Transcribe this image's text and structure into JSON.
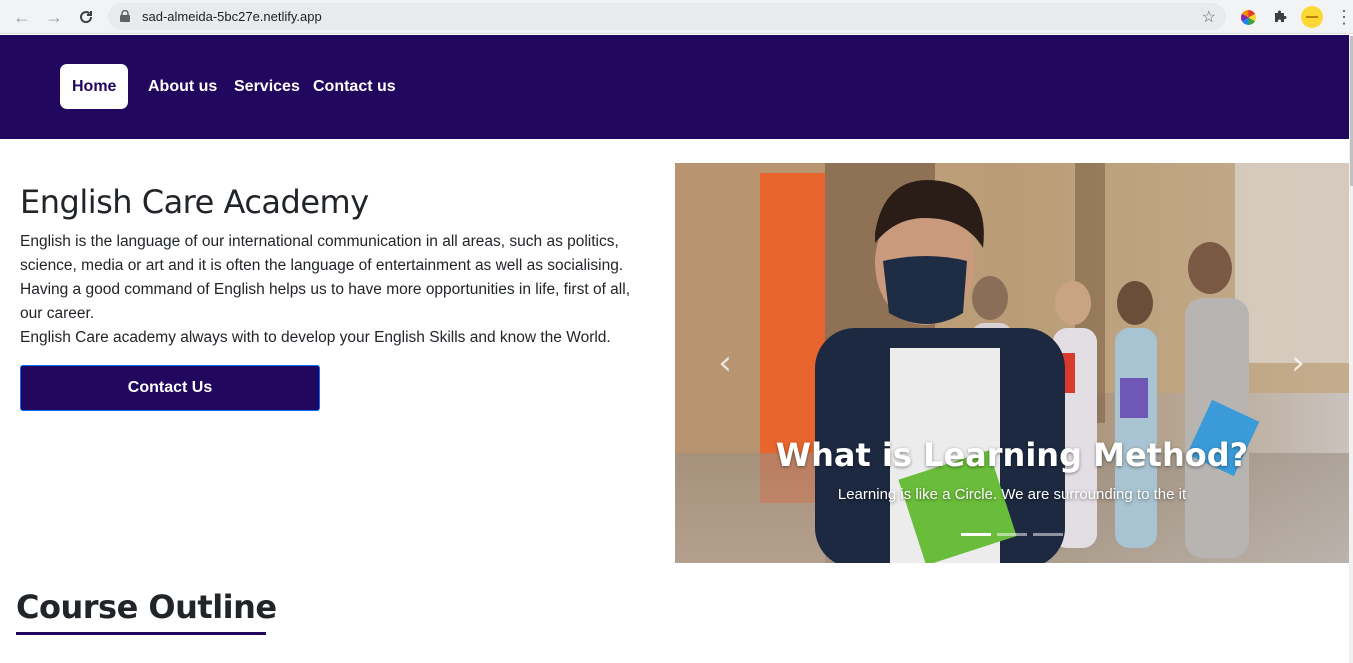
{
  "browser": {
    "url": "sad-almeida-5bc27e.netlify.app"
  },
  "navbar": {
    "items": [
      {
        "label": "Home",
        "active": true
      },
      {
        "label": "About us",
        "active": false
      },
      {
        "label": "Services",
        "active": false
      },
      {
        "label": "Contact us",
        "active": false
      }
    ]
  },
  "hero": {
    "title": "English Care Academy",
    "paragraph_lines": [
      "English is the language of our international communication in all areas, such as politics,",
      "science, media or art and it is often the language of entertainment as well as socialising.",
      "Having a good command of English helps us to have more opportunities in life, first of all,",
      "our career.",
      "English Care academy always with to develop your English Skills and know the World."
    ],
    "cta_label": "Contact Us"
  },
  "carousel": {
    "caption_title": "What is Learning Method?",
    "caption_text": "Learning is like a Circle. We are surrounding to the it",
    "slide_count": 3,
    "active_slide": 1
  },
  "course": {
    "title": "Course Outline"
  },
  "colors": {
    "brand": "#21075e",
    "white": "#ffffff"
  }
}
